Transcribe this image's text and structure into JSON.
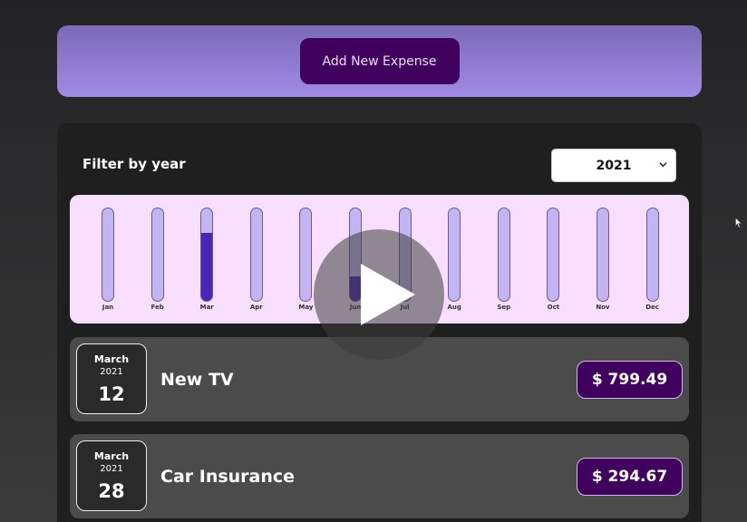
{
  "new_expense": {
    "button_label": "Add New Expense"
  },
  "filter": {
    "label": "Filter by year",
    "selected_year": "2021"
  },
  "chart_data": {
    "type": "bar",
    "categories": [
      "Jan",
      "Feb",
      "Mar",
      "Apr",
      "May",
      "Jun",
      "Jul",
      "Aug",
      "Sep",
      "Oct",
      "Nov",
      "Dec"
    ],
    "values": [
      0,
      0,
      799.49,
      0,
      0,
      294.67,
      0,
      0,
      0,
      0,
      0,
      0
    ],
    "ylim": [
      0,
      1094.16
    ],
    "colors": {
      "empty": "#c3b4f3",
      "fill": "#4826b9",
      "background": "#f8dfff"
    }
  },
  "expenses": [
    {
      "month": "March",
      "year": "2021",
      "day": "12",
      "title": "New TV",
      "amount": "$ 799.49"
    },
    {
      "month": "March",
      "year": "2021",
      "day": "28",
      "title": "Car Insurance",
      "amount": "$ 294.67"
    }
  ],
  "overlay": {
    "icon": "play-icon"
  },
  "colors": {
    "accent": "#40005d",
    "header_gradient_start": "#7a6ab7",
    "header_gradient_end": "#a08be6"
  }
}
